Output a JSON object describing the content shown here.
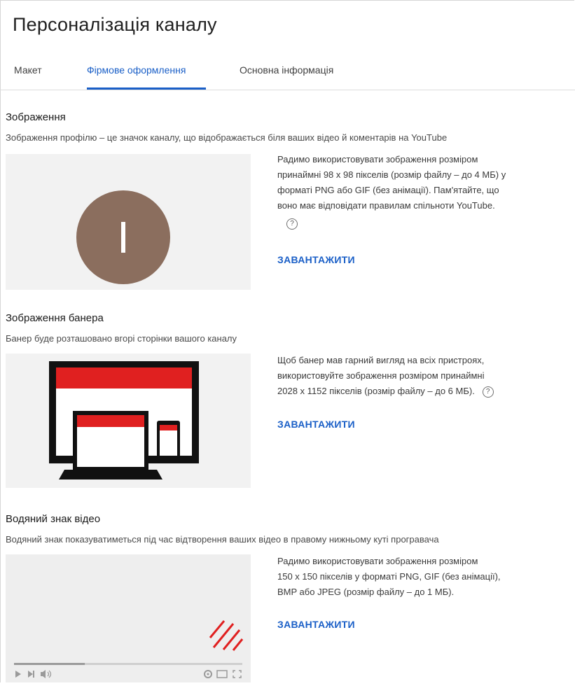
{
  "page_title": "Персоналізація каналу",
  "tabs": [
    {
      "label": "Макет"
    },
    {
      "label": "Фірмове оформлення"
    },
    {
      "label": "Основна інформація"
    }
  ],
  "profile": {
    "title": "Зображення",
    "description": "Зображення профілю – це значок каналу, що відображається біля ваших відео й коментарів на YouTube",
    "avatar_letter": "І",
    "avatar_color": "#8b6e5e",
    "info_lines": [
      "Радимо використовувати зображення розміром",
      "принаймні 98 x 98 пікселів (розмір файлу – до 4 МБ) у",
      "форматі PNG або GIF (без анімації). Пам'ятайте, що",
      "воно має відповідати правилам спільноти YouTube."
    ],
    "help": "?",
    "upload_label": "ЗАВАНТАЖИТИ"
  },
  "banner": {
    "title": "Зображення банера",
    "description": "Банер буде розташовано вгорі сторінки вашого каналу",
    "info_lines": [
      "Щоб банер мав гарний вигляд на всіх пристроях,",
      "використовуйте зображення розміром принаймні",
      "2028 x 1152 пікселів (розмір файлу – до 6 МБ)."
    ],
    "help": "?",
    "upload_label": "ЗАВАНТАЖИТИ",
    "accent_color": "#e02020"
  },
  "watermark": {
    "title": "Водяний знак відео",
    "description": "Водяний знак показуватиметься під час відтворення ваших відео в правому нижньому куті програвача",
    "info_lines": [
      "Радимо використовувати зображення розміром",
      "150 x 150 пікселів у форматі PNG, GIF (без анімації),",
      "BMP або JPEG (розмір файлу – до 1 МБ)."
    ],
    "upload_label": "ЗАВАНТАЖИТИ",
    "player_progress": 0.31,
    "icons": [
      "play-icon",
      "skip-next-icon",
      "volume-icon",
      "settings-icon",
      "theater-mode-icon",
      "fullscreen-icon"
    ]
  }
}
